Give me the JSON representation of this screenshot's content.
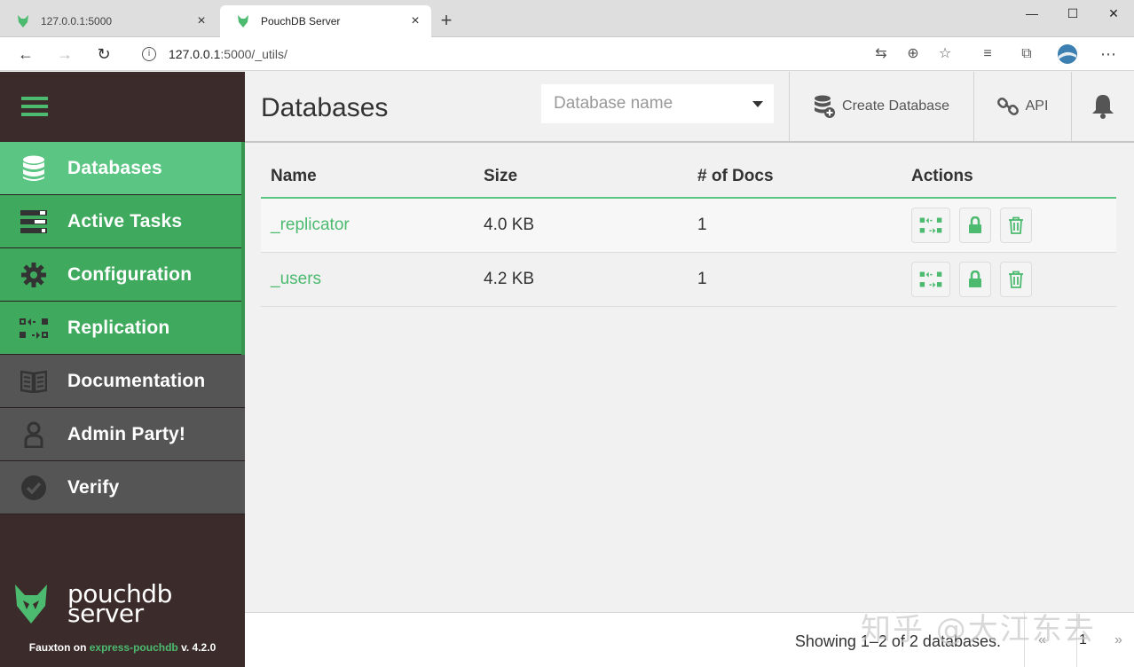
{
  "browser": {
    "tabs": [
      {
        "label": "127.0.0.1:5000",
        "active": false
      },
      {
        "label": "PouchDB Server",
        "active": true
      }
    ],
    "new_tab": "+",
    "url_host": "127.0.0.1",
    "url_rest": ":5000/_utils/",
    "window_controls": {
      "minimize": "—",
      "maximize": "☐",
      "close": "✕"
    }
  },
  "sidebar": {
    "items": [
      {
        "label": "Databases",
        "icon": "database-icon",
        "state": "active"
      },
      {
        "label": "Active Tasks",
        "icon": "tasks-icon",
        "state": "green"
      },
      {
        "label": "Configuration",
        "icon": "gear-icon",
        "state": "green"
      },
      {
        "label": "Replication",
        "icon": "replication-icon",
        "state": "green"
      },
      {
        "label": "Documentation",
        "icon": "book-icon",
        "state": "grey"
      },
      {
        "label": "Admin Party!",
        "icon": "user-icon",
        "state": "grey"
      },
      {
        "label": "Verify",
        "icon": "check-circle-icon",
        "state": "grey"
      }
    ],
    "logo_line1": "pouchdb",
    "logo_line2": "server",
    "footer_prefix": "Fauxton on ",
    "footer_link": "express-pouchdb",
    "footer_version": " v. 4.2.0"
  },
  "header": {
    "title": "Databases",
    "db_select_placeholder": "Database name",
    "create_label": "Create Database",
    "api_label": "API"
  },
  "table": {
    "columns": [
      "Name",
      "Size",
      "# of Docs",
      "Actions"
    ],
    "rows": [
      {
        "name": "_replicator",
        "size": "4.0 KB",
        "docs": "1"
      },
      {
        "name": "_users",
        "size": "4.2 KB",
        "docs": "1"
      }
    ]
  },
  "footer": {
    "showing": "Showing 1–2 of 2 databases.",
    "prev": "«",
    "page": "1",
    "next": "»"
  },
  "watermark": "知乎 @大江东去",
  "colors": {
    "accent_green": "#4cba6f",
    "active_green": "#5bc583",
    "sidebar_dark": "#3b2b2a"
  }
}
